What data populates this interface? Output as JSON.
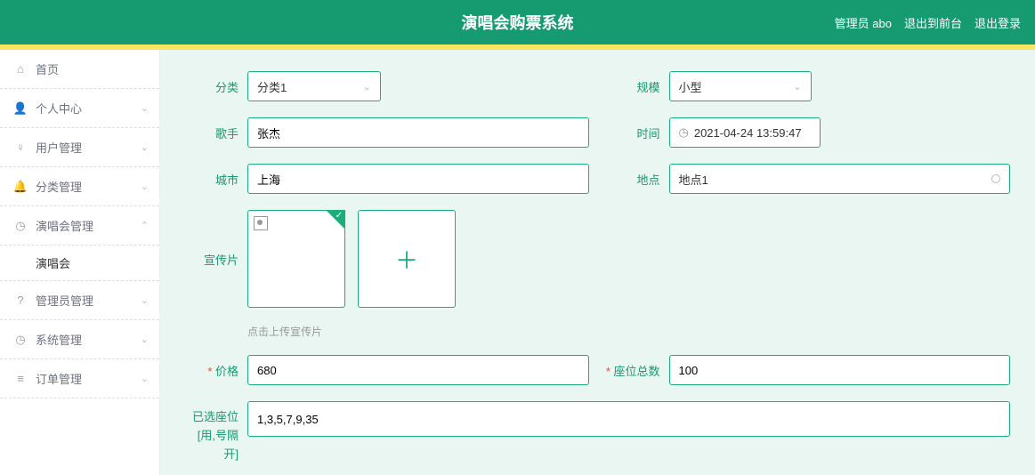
{
  "header": {
    "title": "演唱会购票系统",
    "admin_label": "管理员 abo",
    "exit_front": "退出到前台",
    "logout": "退出登录"
  },
  "sidebar": {
    "items": [
      {
        "label": "首页",
        "icon": "home"
      },
      {
        "label": "个人中心",
        "icon": "user",
        "expandable": true
      },
      {
        "label": "用户管理",
        "icon": "bulb",
        "expandable": true
      },
      {
        "label": "分类管理",
        "icon": "bell",
        "expandable": true
      },
      {
        "label": "演唱会管理",
        "icon": "clock",
        "expandable": true,
        "expanded": true,
        "children": [
          {
            "label": "演唱会"
          }
        ]
      },
      {
        "label": "管理员管理",
        "icon": "help",
        "expandable": true
      },
      {
        "label": "系统管理",
        "icon": "clock",
        "expandable": true
      },
      {
        "label": "订单管理",
        "icon": "list",
        "expandable": true
      }
    ]
  },
  "form": {
    "category_label": "分类",
    "category_value": "分类1",
    "scale_label": "规模",
    "scale_value": "小型",
    "singer_label": "歌手",
    "singer_value": "张杰",
    "time_label": "时间",
    "time_value": "2021-04-24 13:59:47",
    "city_label": "城市",
    "city_value": "上海",
    "venue_label": "地点",
    "venue_value": "地点1",
    "poster_label": "宣传片",
    "poster_helper": "点击上传宣传片",
    "price_label": "价格",
    "price_value": "680",
    "seats_label": "座位总数",
    "seats_value": "100",
    "selected_seats_label": "已选座位\n[用,号隔\n开]",
    "selected_seats_label_l1": "已选座位",
    "selected_seats_label_l2": "[用,号隔",
    "selected_seats_label_l3": "开]",
    "selected_seats_value": "1,3,5,7,9,35"
  }
}
